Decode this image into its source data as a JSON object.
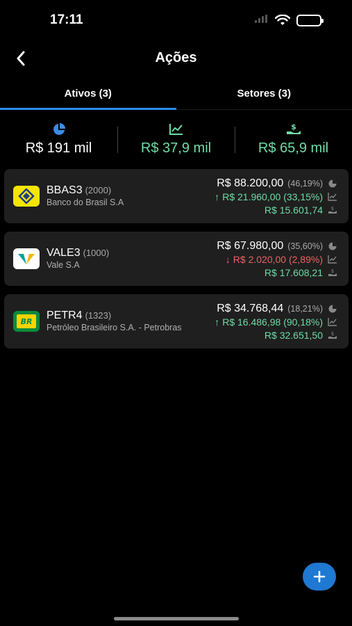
{
  "status": {
    "time": "17:11"
  },
  "nav": {
    "title": "Ações"
  },
  "tabs": [
    {
      "label": "Ativos (3)",
      "active": true
    },
    {
      "label": "Setores (3)",
      "active": false
    }
  ],
  "summary": {
    "total": "R$ 191 mil",
    "gain": "R$ 37,9 mil",
    "dividends": "R$ 65,9 mil"
  },
  "assets": [
    {
      "ticker": "BBAS3",
      "qty": "(2000)",
      "name": "Banco do Brasil S.A",
      "value": "R$ 88.200,00",
      "pct": "(46,19%)",
      "change": "R$ 21.960,00 (33,15%)",
      "direction": "up",
      "dividends": "R$ 15.601,74",
      "logo": "banco-do-brasil-logo"
    },
    {
      "ticker": "VALE3",
      "qty": "(1000)",
      "name": "Vale S.A",
      "value": "R$ 67.980,00",
      "pct": "(35,60%)",
      "change": "R$ 2.020,00 (2,89%)",
      "direction": "down",
      "dividends": "R$ 17.608,21",
      "logo": "vale-logo"
    },
    {
      "ticker": "PETR4",
      "qty": "(1323)",
      "name": "Petróleo Brasileiro S.A. - Petrobras",
      "value": "R$ 34.768,44",
      "pct": "(18,21%)",
      "change": "R$ 16.486,98 (90,18%)",
      "direction": "up",
      "dividends": "R$ 32.651,50",
      "logo": "petrobras-logo",
      "logo_text": "BR"
    }
  ],
  "colors": {
    "accent": "#2d8ce8",
    "green": "#6fdca7",
    "red": "#f06262",
    "card": "#1f1f1f",
    "fab": "#1f78d1"
  }
}
